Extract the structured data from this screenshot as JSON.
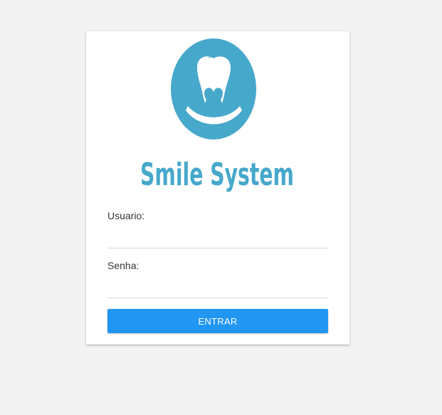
{
  "brand": {
    "name": "Smile System",
    "color": "#46a8cb"
  },
  "form": {
    "username_label": "Usuario:",
    "username_value": "",
    "password_label": "Senha:",
    "password_value": "",
    "submit_label": "ENTRAR",
    "submit_color": "#2196f3"
  }
}
